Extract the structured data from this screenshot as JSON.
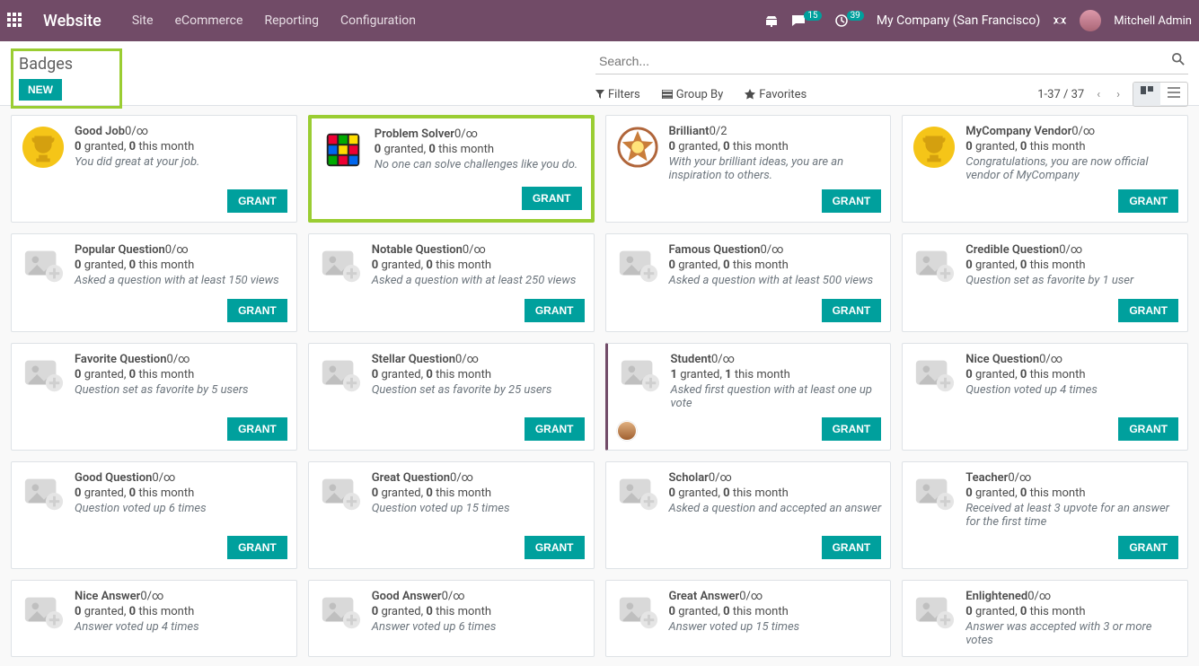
{
  "nav": {
    "brand": "Website",
    "menu": [
      "Site",
      "eCommerce",
      "Reporting",
      "Configuration"
    ],
    "chat_count": "15",
    "clock_count": "39",
    "company": "My Company (San Francisco)",
    "user": "Mitchell Admin"
  },
  "header": {
    "title": "Badges",
    "new_btn": "NEW",
    "search_placeholder": "Search...",
    "filters": "Filters",
    "groupby": "Group By",
    "favorites": "Favorites",
    "pager": "1-37 / 37"
  },
  "grant_label": "GRANT",
  "badges": [
    {
      "name": "Good Job",
      "sub": "0/∞",
      "g1": "0",
      "g2": "0",
      "desc": "You did great at your job.",
      "icon": "trophy-gold"
    },
    {
      "name": "Problem Solver",
      "sub": "0/∞",
      "g1": "0",
      "g2": "0",
      "desc": "No one can solve challenges like you do.",
      "icon": "rubik",
      "highlight": true
    },
    {
      "name": "Brilliant",
      "sub": "0/2",
      "g1": "0",
      "g2": "0",
      "desc": "With your brilliant ideas, you are an inspiration to others.",
      "icon": "star-bronze"
    },
    {
      "name": "MyCompany Vendor",
      "sub": "0/∞",
      "g1": "0",
      "g2": "0",
      "desc": "Congratulations, you are now official vendor of MyCompany",
      "icon": "trophy-gold"
    },
    {
      "name": "Popular Question",
      "sub": "0/∞",
      "g1": "0",
      "g2": "0",
      "desc": "Asked a question with at least 150 views",
      "icon": "placeholder"
    },
    {
      "name": "Notable Question",
      "sub": "0/∞",
      "g1": "0",
      "g2": "0",
      "desc": "Asked a question with at least 250 views",
      "icon": "placeholder"
    },
    {
      "name": "Famous Question",
      "sub": "0/∞",
      "g1": "0",
      "g2": "0",
      "desc": "Asked a question with at least 500 views",
      "icon": "placeholder"
    },
    {
      "name": "Credible Question",
      "sub": "0/∞",
      "g1": "0",
      "g2": "0",
      "desc": "Question set as favorite by 1 user",
      "icon": "placeholder"
    },
    {
      "name": "Favorite Question",
      "sub": "0/∞",
      "g1": "0",
      "g2": "0",
      "desc": "Question set as favorite by 5 users",
      "icon": "placeholder"
    },
    {
      "name": "Stellar Question",
      "sub": "0/∞",
      "g1": "0",
      "g2": "0",
      "desc": "Question set as favorite by 25 users",
      "icon": "placeholder"
    },
    {
      "name": "Student",
      "sub": "0/∞",
      "g1": "1",
      "g2": "1",
      "desc": "Asked first question with at least one up vote",
      "icon": "placeholder",
      "accent": true,
      "avatar": true
    },
    {
      "name": "Nice Question",
      "sub": "0/∞",
      "g1": "0",
      "g2": "0",
      "desc": "Question voted up 4 times",
      "icon": "placeholder"
    },
    {
      "name": "Good Question",
      "sub": "0/∞",
      "g1": "0",
      "g2": "0",
      "desc": "Question voted up 6 times",
      "icon": "placeholder"
    },
    {
      "name": "Great Question",
      "sub": "0/∞",
      "g1": "0",
      "g2": "0",
      "desc": "Question voted up 15 times",
      "icon": "placeholder"
    },
    {
      "name": "Scholar",
      "sub": "0/∞",
      "g1": "0",
      "g2": "0",
      "desc": "Asked a question and accepted an answer",
      "icon": "placeholder"
    },
    {
      "name": "Teacher",
      "sub": "0/∞",
      "g1": "0",
      "g2": "0",
      "desc": "Received at least 3 upvote for an answer for the first time",
      "icon": "placeholder"
    },
    {
      "name": "Nice Answer",
      "sub": "0/∞",
      "g1": "0",
      "g2": "0",
      "desc": "Answer voted up 4 times",
      "icon": "placeholder",
      "cut": true
    },
    {
      "name": "Good Answer",
      "sub": "0/∞",
      "g1": "0",
      "g2": "0",
      "desc": "Answer voted up 6 times",
      "icon": "placeholder",
      "cut": true
    },
    {
      "name": "Great Answer",
      "sub": "0/∞",
      "g1": "0",
      "g2": "0",
      "desc": "Answer voted up 15 times",
      "icon": "placeholder",
      "cut": true
    },
    {
      "name": "Enlightened",
      "sub": "0/∞",
      "g1": "0",
      "g2": "0",
      "desc": "Answer was accepted with 3 or more votes",
      "icon": "placeholder",
      "cut": true
    }
  ]
}
